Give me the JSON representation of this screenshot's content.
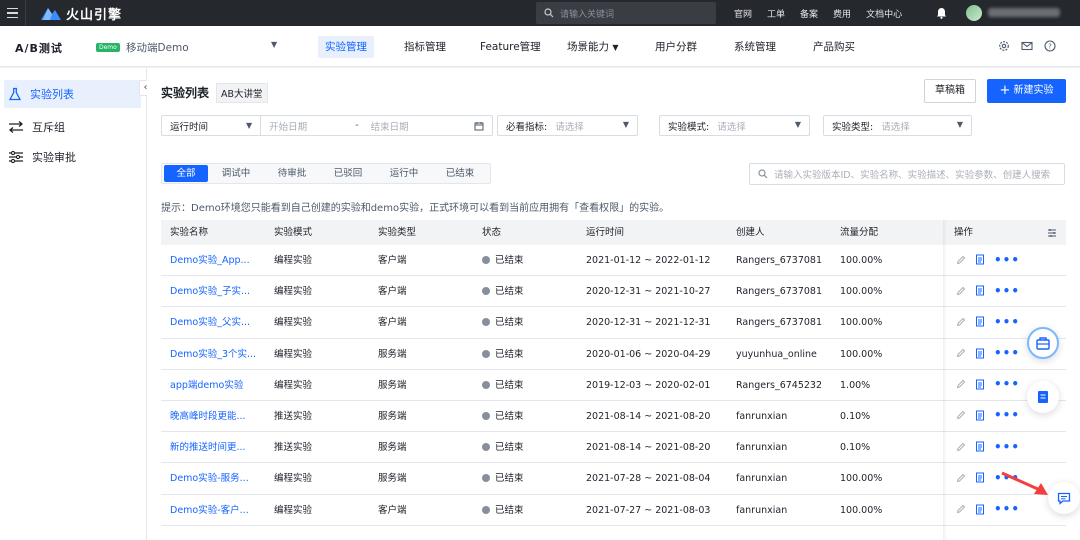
{
  "topbar": {
    "brand": "火山引擎",
    "search_placeholder": "请输入关键词",
    "links": [
      "官网",
      "工单",
      "备案",
      "费用",
      "文档中心"
    ]
  },
  "subnav": {
    "product": "A/B测试",
    "demo_badge": "Demo",
    "app_name": "移动端Demo",
    "tabs": [
      "实验管理",
      "指标管理",
      "Feature管理",
      "场景能力",
      "用户分群",
      "系统管理",
      "产品购买"
    ],
    "active_tab": "实验管理"
  },
  "sidebar": {
    "items": [
      "实验列表",
      "互斥组",
      "实验审批"
    ]
  },
  "main": {
    "title": "实验列表",
    "ab_badge": "AB大讲堂",
    "draft_button": "草稿箱",
    "new_button": "新建实验",
    "filters": {
      "run_time_label": "运行时间",
      "start_date_placeholder": "开始日期",
      "date_sep": "-",
      "end_date_placeholder": "结束日期",
      "metric_label": "必看指标:",
      "metric_placeholder": "请选择",
      "mode_label": "实验模式:",
      "mode_placeholder": "请选择",
      "type_label": "实验类型:",
      "type_placeholder": "请选择"
    },
    "status_tabs": [
      "全部",
      "调试中",
      "待审批",
      "已驳回",
      "运行中",
      "已结束"
    ],
    "table_search_placeholder": "请输入实验版本ID、实验名称、实验描述、实验参数、创建人搜索",
    "hint": "提示：Demo环境您只能看到自己创建的实验和demo实验，正式环境可以看到当前应用拥有「查看权限」的实验。",
    "columns": [
      "实验名称",
      "实验模式",
      "实验类型",
      "状态",
      "运行时间",
      "创建人",
      "流量分配",
      "操作"
    ],
    "rows": [
      {
        "name": "Demo实验_App...",
        "mode": "编程实验",
        "type": "客户端",
        "status": "已结束",
        "time": "2021-01-12 ~ 2022-01-12",
        "creator": "Rangers_6737081",
        "traffic": "100.00%"
      },
      {
        "name": "Demo实验_子实...",
        "mode": "编程实验",
        "type": "客户端",
        "status": "已结束",
        "time": "2020-12-31 ~ 2021-10-27",
        "creator": "Rangers_6737081",
        "traffic": "100.00%"
      },
      {
        "name": "Demo实验_父实...",
        "mode": "编程实验",
        "type": "客户端",
        "status": "已结束",
        "time": "2020-12-31 ~ 2021-12-31",
        "creator": "Rangers_6737081",
        "traffic": "100.00%"
      },
      {
        "name": "Demo实验_3个实...",
        "mode": "编程实验",
        "type": "服务端",
        "status": "已结束",
        "time": "2020-01-06 ~ 2020-04-29",
        "creator": "yuyunhua_online",
        "traffic": "100.00%"
      },
      {
        "name": "app端demo实验",
        "mode": "编程实验",
        "type": "服务端",
        "status": "已结束",
        "time": "2019-12-03 ~ 2020-02-01",
        "creator": "Rangers_6745232",
        "traffic": "1.00%"
      },
      {
        "name": "晚高峰时段更能...",
        "mode": "推送实验",
        "type": "服务端",
        "status": "已结束",
        "time": "2021-08-14 ~ 2021-08-20",
        "creator": "fanrunxian",
        "traffic": "0.10%"
      },
      {
        "name": "新的推送时间更...",
        "mode": "推送实验",
        "type": "服务端",
        "status": "已结束",
        "time": "2021-08-14 ~ 2021-08-20",
        "creator": "fanrunxian",
        "traffic": "0.10%"
      },
      {
        "name": "Demo实验-服务...",
        "mode": "编程实验",
        "type": "服务端",
        "status": "已结束",
        "time": "2021-07-28 ~ 2021-08-04",
        "creator": "fanrunxian",
        "traffic": "100.00%"
      },
      {
        "name": "Demo实验-客户...",
        "mode": "编程实验",
        "type": "客户端",
        "status": "已结束",
        "time": "2021-07-27 ~ 2021-08-03",
        "creator": "fanrunxian",
        "traffic": "100.00%"
      }
    ]
  },
  "colors": {
    "accent": "#1664ff",
    "topbar": "#25282d",
    "status_dot": "#86909c",
    "arrow": "#f53f3f"
  }
}
